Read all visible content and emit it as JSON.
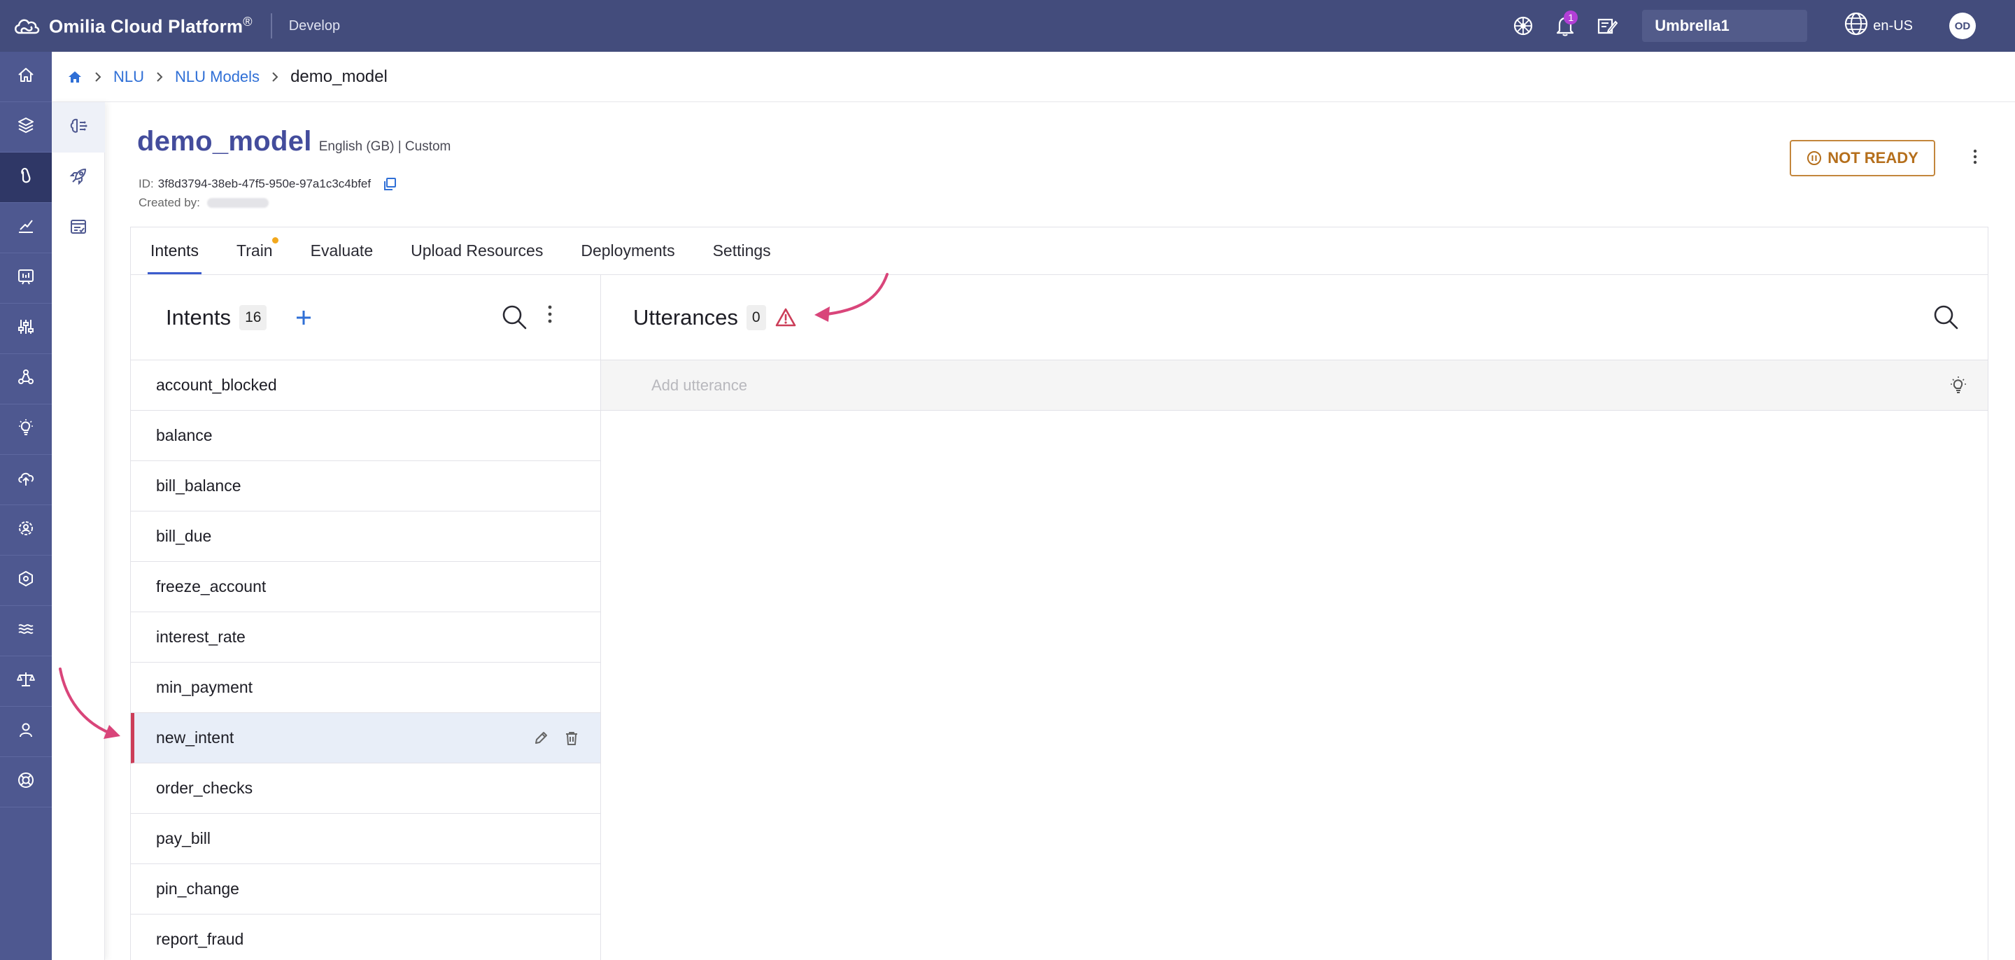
{
  "topbar": {
    "brand_name": "Omilia Cloud Platform",
    "brand_mark": "®",
    "section": "Develop",
    "notifications_count": "1",
    "org_name": "Umbrella1",
    "language": "en-US",
    "avatar_initials": "OD"
  },
  "breadcrumb": {
    "items": [
      "NLU",
      "NLU Models"
    ],
    "current": "demo_model"
  },
  "model": {
    "name": "demo_model",
    "meta": "English (GB) | Custom",
    "id_label": "ID:",
    "id_value": "3f8d3794-38eb-47f5-950e-97a1c3c4bfef",
    "created_label": "Created by:",
    "status": "NOT READY"
  },
  "tabs": [
    "Intents",
    "Train",
    "Evaluate",
    "Upload Resources",
    "Deployments",
    "Settings"
  ],
  "intents": {
    "title": "Intents",
    "count": "16",
    "items": [
      "account_blocked",
      "balance",
      "bill_balance",
      "bill_due",
      "freeze_account",
      "interest_rate",
      "min_payment",
      "new_intent",
      "order_checks",
      "pay_bill",
      "pin_change",
      "report_fraud"
    ],
    "selected_index": 7
  },
  "utterances": {
    "title": "Utterances",
    "count": "0",
    "input_placeholder": "Add utterance"
  },
  "colors": {
    "topbar": "#434c7c",
    "rail": "#4e5890",
    "accent": "#3c5ccd",
    "link": "#2f6fd6",
    "warning": "#cc3d58",
    "status": "#c3863c",
    "annotation": "#d9457a"
  }
}
